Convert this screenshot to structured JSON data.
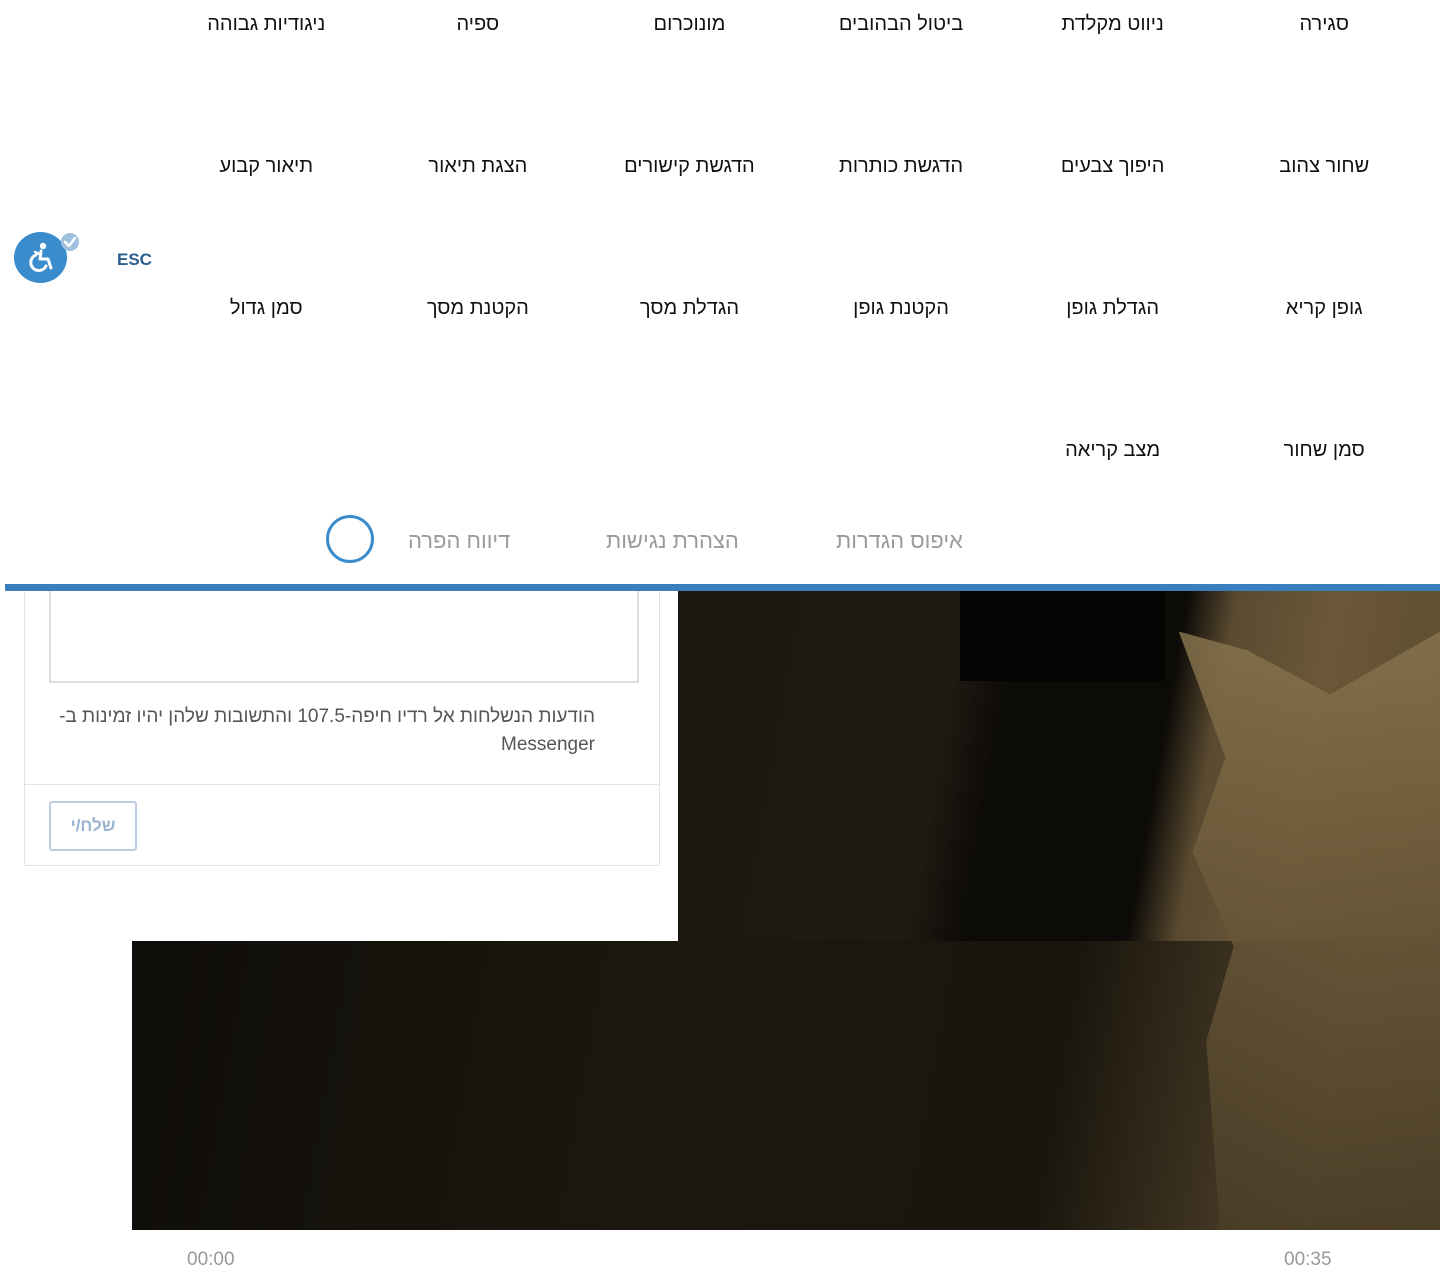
{
  "accessibility_menu": {
    "items": [
      "סגירה",
      "ניווט מקלדת",
      "ביטול הבהובים",
      "מונוכרום",
      "ספיה",
      "ניגודיות גבוהה",
      "שחור צהוב",
      "היפוך צבעים",
      "הדגשת כותרות",
      "הדגשת קישורים",
      "הצגת תיאור",
      "תיאור קבוע",
      "גופן קריא",
      "הגדלת גופן",
      "הקטנת גופן",
      "הגדלת מסך",
      "הקטנת מסך",
      "סמן גדול",
      "סמן שחור",
      "מצב קריאה"
    ],
    "esc_label": "ESC",
    "icon": "wheelchair-accessibility-icon",
    "footer": {
      "reset": "איפוס הגדרות",
      "statement": "הצהרת נגישות",
      "report": "דיווח הפרה"
    }
  },
  "messenger": {
    "note": "הודעות הנשלחות אל רדיו חיפה-107.5 והתשובות שלהן יהיו זמינות ב-Messenger",
    "send_label": "שלח/י"
  },
  "player": {
    "current_time": "00:00",
    "duration": "00:35"
  },
  "colors": {
    "accent": "#3a8ccd",
    "bar": "#3a7fbd"
  }
}
